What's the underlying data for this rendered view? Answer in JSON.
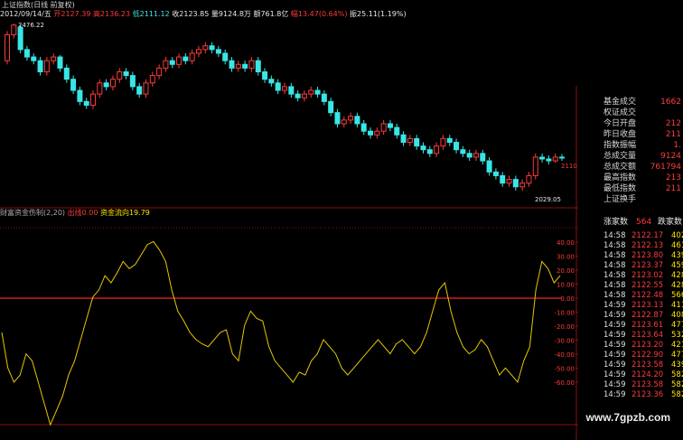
{
  "header": {
    "title": "上证指数(日线 前复权)",
    "date": "2012/09/14/五",
    "open_label": "开",
    "open": "2127.39",
    "high_label": "高",
    "high": "2136.23",
    "low_label": "低",
    "low": "2111.12",
    "close_label": "收",
    "close": "2123.85",
    "volume_label": "量",
    "volume": "9124.8万",
    "amount_label": "额",
    "amount": "761.8亿",
    "change_label": "幅",
    "change": "13.47(0.64%)",
    "amplitude_label": "振",
    "amplitude": "25.11(1.19%)"
  },
  "price_chart": {
    "max_label": "2476.22",
    "min_label": "2029.05",
    "axis_labels": [
      "2110"
    ]
  },
  "indicator": {
    "name": "财富资金伤制(2,20)",
    "line1_label": "出线",
    "line1_value": "0.00",
    "line2_label": "资金流向",
    "line2_value": "19.79",
    "axis_labels": [
      "40.00",
      "30.00",
      "20.00",
      "10.00",
      "0.00",
      "-10.00",
      "-20.00",
      "-30.00",
      "-40.00",
      "-50.00",
      "-60.00"
    ]
  },
  "side_panel": {
    "rows": [
      {
        "k": "",
        "v": ""
      },
      {
        "k": "基金成交",
        "v": "1662"
      },
      {
        "k": "权证成交",
        "v": ""
      },
      {
        "k": "今日开盘",
        "v": "212"
      },
      {
        "k": "昨日收盘",
        "v": "211"
      },
      {
        "k": "指数振幅",
        "v": "1."
      },
      {
        "k": "总成交量",
        "v": "9124"
      },
      {
        "k": "总成交额",
        "v": "761794"
      },
      {
        "k": "最高指数",
        "v": "213"
      },
      {
        "k": "最低指数",
        "v": "211"
      },
      {
        "k": "上证换手",
        "v": ""
      }
    ],
    "up_label": "涨家数",
    "up_count": "564",
    "down_label": "跌家数",
    "down_count": ""
  },
  "ticks": [
    {
      "t": "14:58",
      "p": "2122.17",
      "v": "402"
    },
    {
      "t": "14:58",
      "p": "2122.13",
      "v": "461"
    },
    {
      "t": "14:58",
      "p": "2123.80",
      "v": "439"
    },
    {
      "t": "14:58",
      "p": "2123.37",
      "v": "459"
    },
    {
      "t": "14:58",
      "p": "2123.02",
      "v": "428"
    },
    {
      "t": "14:58",
      "p": "2122.55",
      "v": "428"
    },
    {
      "t": "14:58",
      "p": "2122.48",
      "v": "566"
    },
    {
      "t": "14:59",
      "p": "2123.13",
      "v": "411"
    },
    {
      "t": "14:59",
      "p": "2122.87",
      "v": "408"
    },
    {
      "t": "14:59",
      "p": "2123.61",
      "v": "477"
    },
    {
      "t": "14:59",
      "p": "2123.64",
      "v": "532"
    },
    {
      "t": "14:59",
      "p": "2123.20",
      "v": "421"
    },
    {
      "t": "14:59",
      "p": "2122.90",
      "v": "477"
    },
    {
      "t": "14:59",
      "p": "2123.58",
      "v": "439"
    },
    {
      "t": "14:59",
      "p": "2124.20",
      "v": "582"
    },
    {
      "t": "14:59",
      "p": "2123.58",
      "v": "582"
    },
    {
      "t": "14:59",
      "p": "2123.36",
      "v": "582"
    }
  ],
  "colors": {
    "up": "#ff3b3b",
    "down": "#39e6e6",
    "indicator": "#e6c800",
    "zero_line": "#cc1a1a",
    "grid": "#8a1010"
  },
  "candles": [
    [
      2380,
      2450,
      2460,
      2370
    ],
    [
      2450,
      2476,
      2480,
      2440
    ],
    [
      2470,
      2410,
      2478,
      2400
    ],
    [
      2410,
      2390,
      2420,
      2380
    ],
    [
      2390,
      2380,
      2400,
      2370
    ],
    [
      2380,
      2350,
      2390,
      2340
    ],
    [
      2350,
      2380,
      2390,
      2340
    ],
    [
      2380,
      2390,
      2400,
      2370
    ],
    [
      2390,
      2360,
      2395,
      2350
    ],
    [
      2360,
      2330,
      2370,
      2320
    ],
    [
      2330,
      2300,
      2340,
      2290
    ],
    [
      2300,
      2270,
      2310,
      2260
    ],
    [
      2270,
      2260,
      2280,
      2250
    ],
    [
      2260,
      2290,
      2300,
      2250
    ],
    [
      2290,
      2320,
      2330,
      2280
    ],
    [
      2320,
      2310,
      2330,
      2300
    ],
    [
      2310,
      2330,
      2340,
      2300
    ],
    [
      2330,
      2350,
      2360,
      2320
    ],
    [
      2350,
      2340,
      2360,
      2330
    ],
    [
      2340,
      2310,
      2350,
      2300
    ],
    [
      2310,
      2290,
      2320,
      2280
    ],
    [
      2290,
      2320,
      2330,
      2280
    ],
    [
      2320,
      2340,
      2350,
      2310
    ],
    [
      2340,
      2360,
      2370,
      2330
    ],
    [
      2360,
      2380,
      2390,
      2350
    ],
    [
      2380,
      2370,
      2390,
      2360
    ],
    [
      2370,
      2390,
      2400,
      2360
    ],
    [
      2390,
      2380,
      2400,
      2370
    ],
    [
      2380,
      2400,
      2410,
      2370
    ],
    [
      2400,
      2410,
      2420,
      2390
    ],
    [
      2410,
      2420,
      2430,
      2400
    ],
    [
      2420,
      2410,
      2430,
      2400
    ],
    [
      2410,
      2400,
      2420,
      2390
    ],
    [
      2400,
      2380,
      2410,
      2370
    ],
    [
      2380,
      2360,
      2390,
      2350
    ],
    [
      2360,
      2370,
      2380,
      2350
    ],
    [
      2370,
      2360,
      2380,
      2350
    ],
    [
      2360,
      2380,
      2390,
      2350
    ],
    [
      2380,
      2350,
      2390,
      2340
    ],
    [
      2350,
      2330,
      2360,
      2320
    ],
    [
      2330,
      2320,
      2340,
      2310
    ],
    [
      2320,
      2300,
      2330,
      2290
    ],
    [
      2300,
      2310,
      2320,
      2290
    ],
    [
      2310,
      2290,
      2320,
      2280
    ],
    [
      2290,
      2280,
      2300,
      2270
    ],
    [
      2280,
      2290,
      2300,
      2270
    ],
    [
      2290,
      2300,
      2310,
      2280
    ],
    [
      2300,
      2290,
      2310,
      2280
    ],
    [
      2290,
      2270,
      2300,
      2260
    ],
    [
      2270,
      2240,
      2280,
      2230
    ],
    [
      2240,
      2210,
      2250,
      2200
    ],
    [
      2210,
      2220,
      2230,
      2200
    ],
    [
      2220,
      2230,
      2240,
      2210
    ],
    [
      2230,
      2210,
      2240,
      2200
    ],
    [
      2210,
      2190,
      2220,
      2180
    ],
    [
      2190,
      2180,
      2200,
      2170
    ],
    [
      2180,
      2190,
      2200,
      2170
    ],
    [
      2190,
      2210,
      2220,
      2180
    ],
    [
      2210,
      2200,
      2220,
      2190
    ],
    [
      2200,
      2180,
      2210,
      2170
    ],
    [
      2180,
      2160,
      2190,
      2150
    ],
    [
      2160,
      2170,
      2180,
      2150
    ],
    [
      2170,
      2150,
      2180,
      2140
    ],
    [
      2150,
      2140,
      2160,
      2130
    ],
    [
      2140,
      2130,
      2150,
      2120
    ],
    [
      2130,
      2150,
      2160,
      2120
    ],
    [
      2150,
      2170,
      2180,
      2140
    ],
    [
      2170,
      2160,
      2180,
      2150
    ],
    [
      2160,
      2140,
      2170,
      2130
    ],
    [
      2140,
      2130,
      2150,
      2120
    ],
    [
      2130,
      2120,
      2140,
      2110
    ],
    [
      2120,
      2130,
      2140,
      2110
    ],
    [
      2130,
      2110,
      2140,
      2100
    ],
    [
      2110,
      2080,
      2120,
      2070
    ],
    [
      2080,
      2070,
      2090,
      2060
    ],
    [
      2070,
      2050,
      2080,
      2040
    ],
    [
      2050,
      2060,
      2070,
      2040
    ],
    [
      2060,
      2040,
      2070,
      2030
    ],
    [
      2040,
      2050,
      2060,
      2029
    ],
    [
      2050,
      2070,
      2080,
      2040
    ],
    [
      2070,
      2120,
      2130,
      2060
    ],
    [
      2120,
      2115,
      2130,
      2105
    ],
    [
      2115,
      2110,
      2125,
      2100
    ],
    [
      2110,
      2120,
      2130,
      2105
    ],
    [
      2120,
      2118,
      2128,
      2110
    ]
  ],
  "indicator_series": [
    -20,
    -45,
    -55,
    -50,
    -35,
    -40,
    -55,
    -70,
    -85,
    -75,
    -65,
    -50,
    -40,
    -25,
    -10,
    5,
    10,
    20,
    15,
    22,
    30,
    25,
    28,
    35,
    42,
    44,
    38,
    30,
    10,
    -5,
    -12,
    -20,
    -25,
    -28,
    -30,
    -25,
    -20,
    -18,
    -35,
    -40,
    -15,
    -5,
    -10,
    -12,
    -30,
    -40,
    -45,
    -50,
    -55,
    -48,
    -50,
    -40,
    -35,
    -25,
    -30,
    -35,
    -45,
    -50,
    -45,
    -40,
    -35,
    -30,
    -25,
    -30,
    -35,
    -28,
    -25,
    -30,
    -35,
    -30,
    -20,
    -5,
    10,
    15,
    -5,
    -20,
    -30,
    -35,
    -32,
    -25,
    -30,
    -40,
    -50,
    -45,
    -50,
    -55,
    -40,
    -30,
    10,
    30,
    25,
    15,
    20
  ]
}
